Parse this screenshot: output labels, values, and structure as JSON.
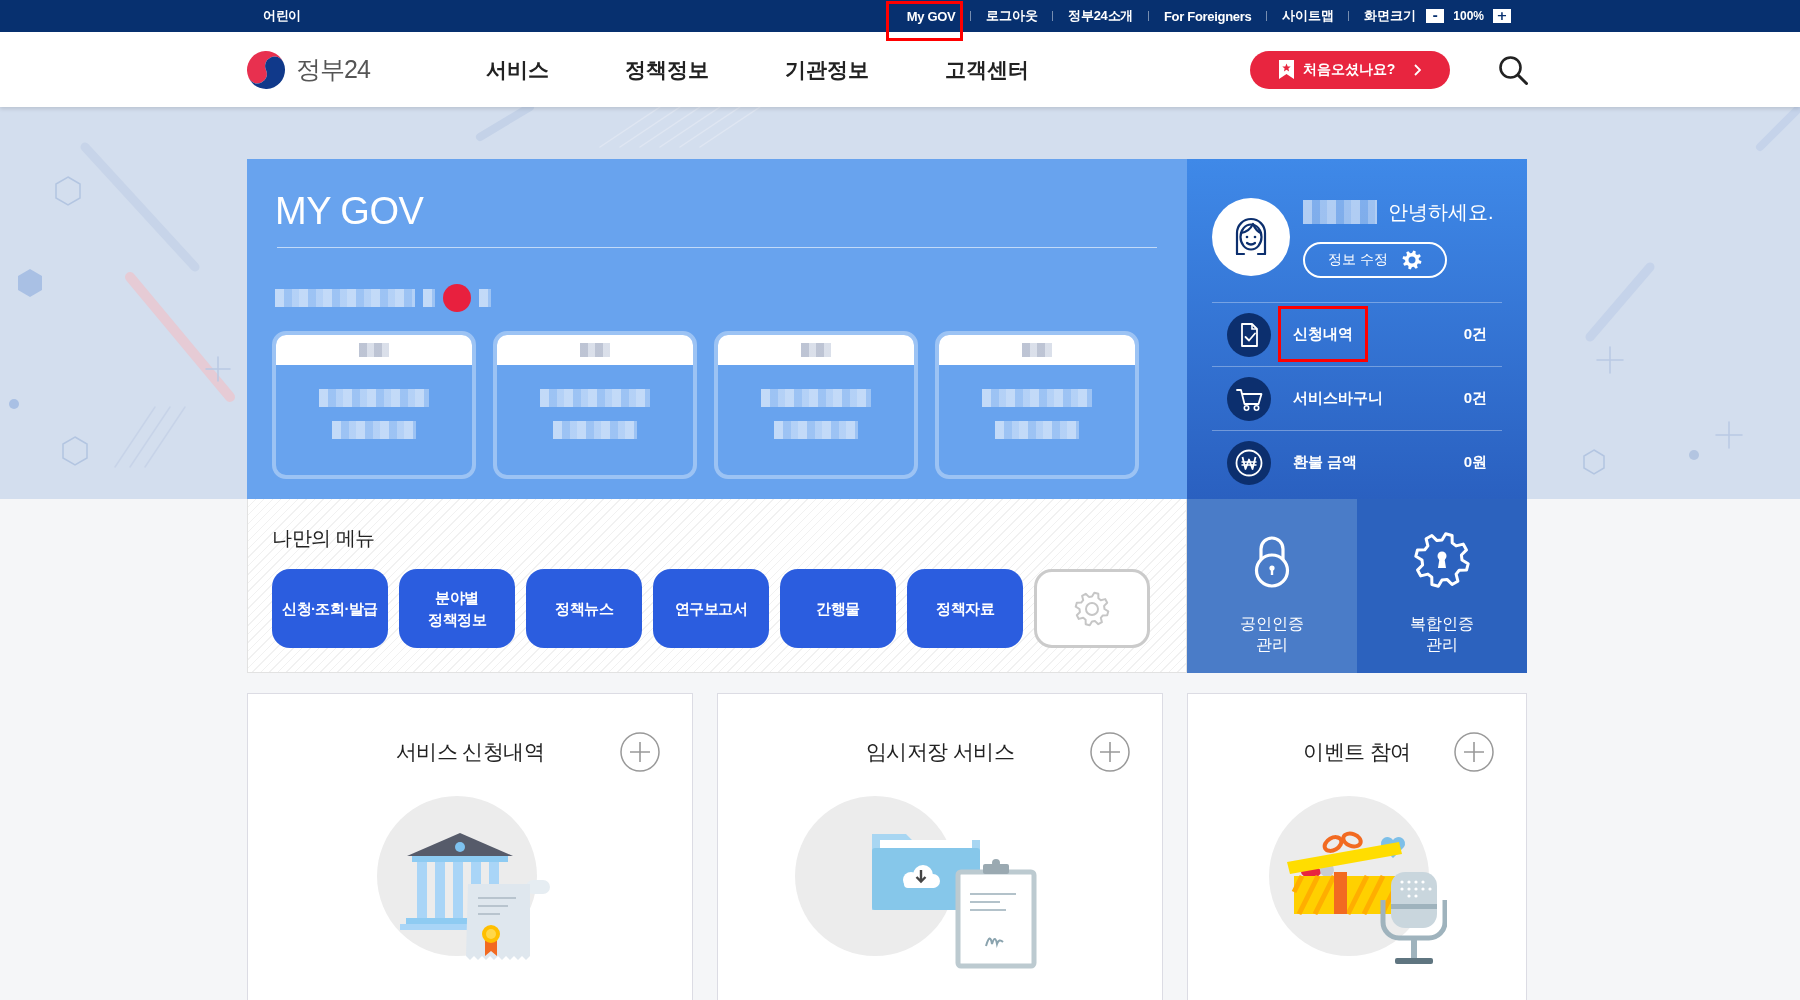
{
  "top_bar": {
    "left_link": "어린이",
    "links": [
      {
        "label": "My GOV",
        "highlighted": true
      },
      {
        "label": "로그아웃",
        "highlighted": false
      },
      {
        "label": "정부24소개",
        "highlighted": false
      },
      {
        "label": "For Foreigners",
        "highlighted": false
      },
      {
        "label": "사이트맵",
        "highlighted": false
      }
    ],
    "zoom": {
      "label": "화면크기",
      "decrease": "-",
      "value": "100%",
      "increase": "+"
    }
  },
  "header": {
    "logo": "정부24",
    "nav": [
      "서비스",
      "정책정보",
      "기관정보",
      "고객센터"
    ],
    "cta": "처음오셨나요?"
  },
  "my_gov": {
    "title": "MY GOV"
  },
  "profile": {
    "greeting": "안녕하세요.",
    "edit_button": "정보 수정",
    "stats": [
      {
        "kind": "document",
        "label": "신청내역",
        "value": "0건",
        "highlighted": true
      },
      {
        "kind": "cart",
        "label": "서비스바구니",
        "value": "0건",
        "highlighted": false
      },
      {
        "kind": "won",
        "label": "환불 금액",
        "value": "0원",
        "highlighted": false
      }
    ],
    "tiles": [
      {
        "kind": "lock",
        "label": "공인인증\n관리",
        "selected": true
      },
      {
        "kind": "gear",
        "label": "복합인증\n관리",
        "selected": false
      }
    ]
  },
  "my_menu": {
    "title": "나만의 메뉴",
    "items": [
      {
        "kind": "link",
        "label": "신청·조회·발급"
      },
      {
        "kind": "link",
        "label": "분야별\n정책정보"
      },
      {
        "kind": "link",
        "label": "정책뉴스"
      },
      {
        "kind": "link",
        "label": "연구보고서"
      },
      {
        "kind": "link",
        "label": "간행물"
      },
      {
        "kind": "link",
        "label": "정책자료"
      },
      {
        "kind": "settings"
      }
    ]
  },
  "cards": [
    {
      "kind": "bank",
      "title": "서비스 신청내역"
    },
    {
      "kind": "folder",
      "title": "임시저장 서비스"
    },
    {
      "kind": "gift",
      "title": "이벤트 참여"
    }
  ]
}
